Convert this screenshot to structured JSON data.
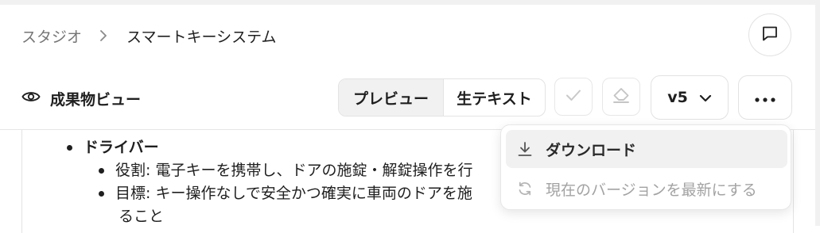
{
  "breadcrumb": {
    "root": "スタジオ",
    "separator_icon": "chevron-right-icon",
    "current": "スマートキーシステム"
  },
  "header": {
    "chat_icon": "chat-bubble-icon"
  },
  "toolbar": {
    "view_icon": "eye-icon",
    "view_label": "成果物ビュー",
    "preview_label": "プレビュー",
    "raw_label": "生テキスト",
    "check_icon": "check-icon",
    "erase_icon": "eraser-icon",
    "version_label": "v5",
    "version_icon": "chevron-down-icon",
    "more_icon": "more-horizontal-icon"
  },
  "content": {
    "section_title": "ドライバー",
    "items": [
      "役割: 電子キーを携帯し、ドアの施錠・解錠操作を行",
      "目標: キー操作なしで安全かつ確実に車両のドアを施"
    ],
    "continuation": "ること"
  },
  "menu": {
    "download_label": "ダウンロード",
    "download_icon": "download-icon",
    "update_label": "現在のバージョンを最新にする",
    "update_icon": "refresh-icon"
  },
  "colors": {
    "text": "#1f1f1f",
    "muted": "#757575",
    "disabled": "#a3a3a3",
    "border": "#e3e3e3",
    "selected_bg": "#f1f1f1"
  }
}
